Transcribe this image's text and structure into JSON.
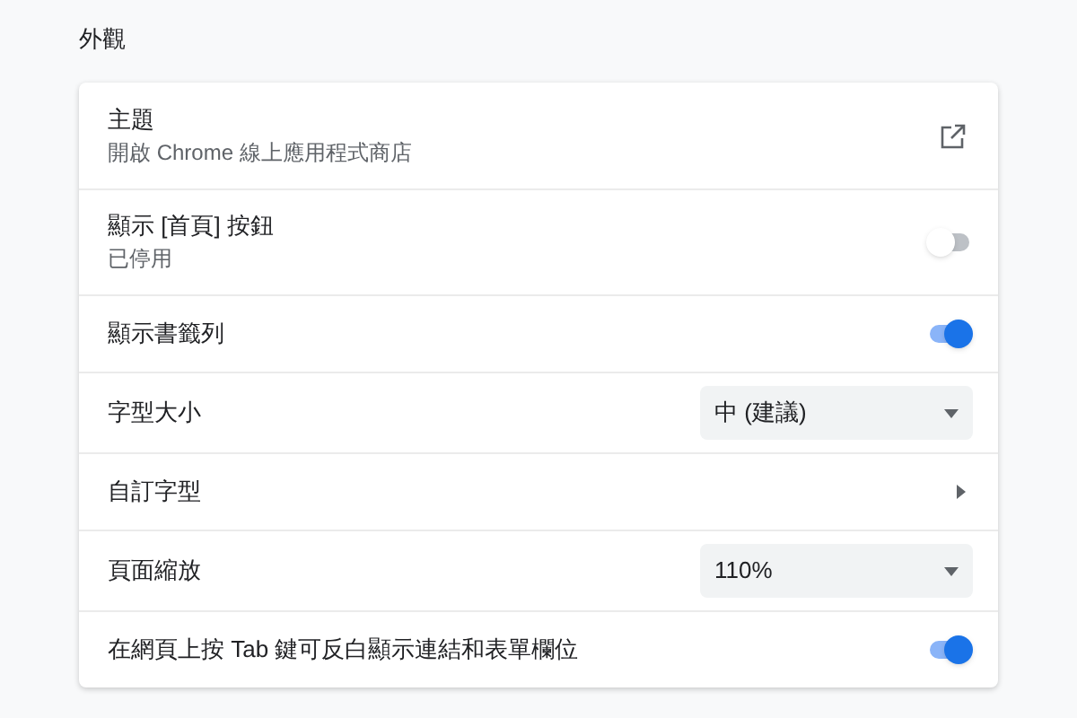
{
  "section_title": "外觀",
  "rows": [
    {
      "kind": "link",
      "label": "主題",
      "sublabel": "開啟 Chrome 線上應用程式商店"
    },
    {
      "kind": "toggle",
      "label": "顯示 [首頁] 按鈕",
      "sublabel": "已停用",
      "on": false
    },
    {
      "kind": "toggle",
      "label": "顯示書籤列",
      "on": true
    },
    {
      "kind": "select",
      "label": "字型大小",
      "value": "中 (建議)"
    },
    {
      "kind": "submenu",
      "label": "自訂字型"
    },
    {
      "kind": "select",
      "label": "頁面縮放",
      "value": "110%"
    },
    {
      "kind": "toggle",
      "label": "在網頁上按 Tab 鍵可反白顯示連結和表單欄位",
      "on": true
    }
  ]
}
